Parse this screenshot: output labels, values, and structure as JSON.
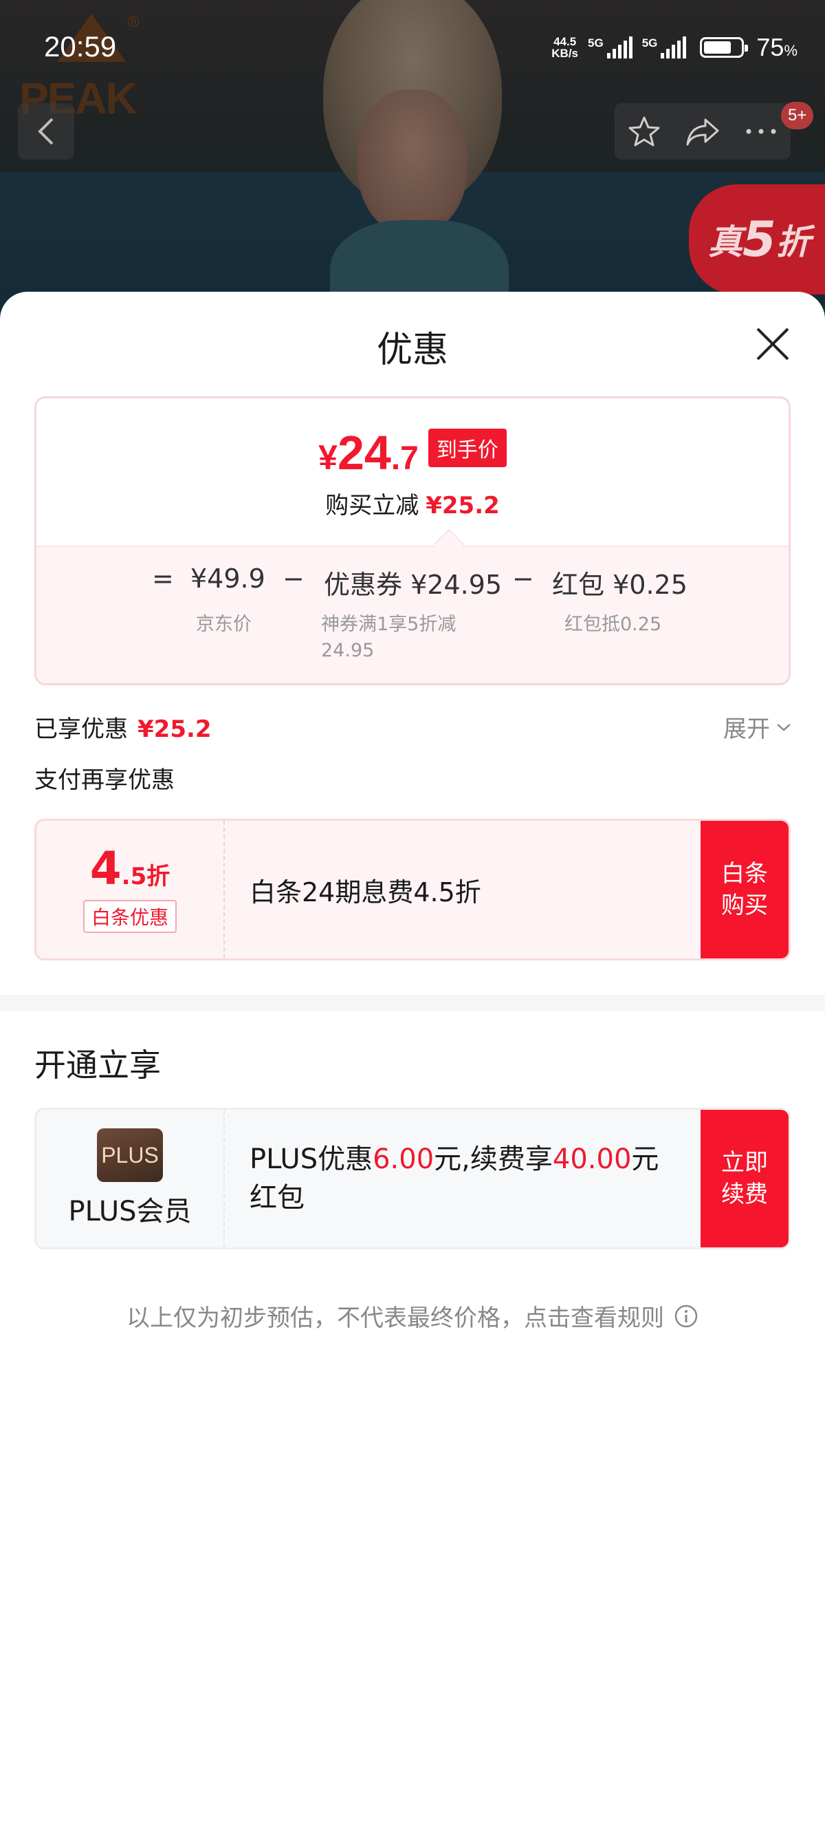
{
  "status_bar": {
    "time": "20:59",
    "net_speed_value": "44.5",
    "net_speed_unit": "KB/s",
    "network_1": "5G",
    "network_2": "5G",
    "battery_level": 0.75,
    "battery_value": "75",
    "battery_unit": "%"
  },
  "header_bar": {
    "badge_count": "5+",
    "brand_logo_text": "PEAK",
    "promo_tag_prefix": "真",
    "promo_tag_number": "5",
    "promo_tag_suffix": "折"
  },
  "sheet": {
    "title": "优惠"
  },
  "price_card": {
    "currency": "¥",
    "final_int": "24",
    "final_dec": ".7",
    "final_tag": "到手价",
    "save_label": "购买立减",
    "save_amount": "¥25.2",
    "equals": "=",
    "jd_price": "¥49.9",
    "minus_1": "−",
    "coupon_label": "优惠券",
    "coupon_amount": "¥24.95",
    "minus_2": "−",
    "redpacket_label": "红包",
    "redpacket_amount": "¥0.25",
    "jd_price_label": "京东价",
    "coupon_desc_line1": "神券满1享5折减",
    "coupon_desc_line2": "24.95",
    "redpacket_desc": "红包抵0.25"
  },
  "summary": {
    "enjoyed_label": "已享优惠",
    "enjoyed_amount": "¥25.2",
    "expand_label": "展开",
    "pay_more_label": "支付再享优惠"
  },
  "baitiao_offer": {
    "discount_big": "4",
    "discount_small": ".5折",
    "tag": "白条优惠",
    "description": "白条24期息费4.5折",
    "cta_line1": "白条",
    "cta_line2": "购买"
  },
  "plus_section": {
    "title": "开通立享",
    "logo_text": "PLUS",
    "name": "PLUS会员",
    "text_part1": "PLUS优惠",
    "amount_1": "6.00",
    "text_part2": "元,续费享",
    "amount_2": "40.00",
    "text_part3": "元",
    "text_line2": "红包",
    "cta_line1": "立即",
    "cta_line2": "续费"
  },
  "footer": {
    "disclaimer": "以上仅为初步预估，不代表最终价格，点击查看规则"
  },
  "colors": {
    "accent_red": "#f0192e",
    "cta_red": "#f5162d",
    "muted_text": "#888888",
    "plus_brown": "#6f4a37"
  },
  "icons": [
    "back-arrow-icon",
    "star-icon",
    "share-icon",
    "more-icon",
    "close-icon",
    "chevron-down-icon",
    "info-icon"
  ]
}
